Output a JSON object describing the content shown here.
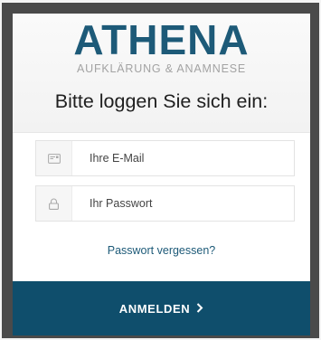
{
  "brand": {
    "name": "ATHENA",
    "tagline": "AUFKLÄRUNG & ANAMNESE"
  },
  "login": {
    "heading": "Bitte loggen Sie sich ein:",
    "email_placeholder": "Ihre E-Mail",
    "email_value": "",
    "password_placeholder": "Ihr Passwort",
    "password_value": "",
    "forgot_link": "Passwort vergessen?",
    "submit_label": "ANMELDEN"
  },
  "icons": {
    "email": "envelope-icon",
    "password": "lock-icon",
    "submit": "chevron-right-icon"
  },
  "colors": {
    "brand": "#1d5a78",
    "button_bg": "#0f4e6c",
    "tagline": "#a3a3a3"
  }
}
